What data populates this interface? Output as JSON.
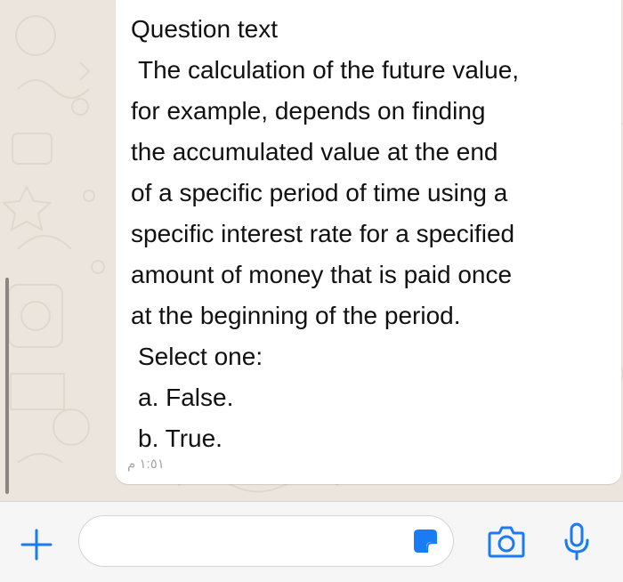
{
  "message": {
    "lines": [
      "Question text",
      " The calculation of the future value,",
      "for example, depends on finding",
      "the accumulated value at the end",
      "of a specific period of time using a",
      "specific interest rate for a specified",
      "amount of money that is paid once",
      "at the beginning of the period.",
      "Select one:",
      "a.  False.",
      "b.  True."
    ],
    "timestamp": "١:٥١ م"
  },
  "input_bar": {
    "message_value": "",
    "icons": [
      "plus-icon",
      "sticker-icon",
      "camera-icon",
      "mic-icon"
    ]
  },
  "colors": {
    "accent": "#1a7cf5",
    "chat_background": "#ece5dd",
    "bubble": "#ffffff",
    "timestamp": "#a5a5a5"
  }
}
